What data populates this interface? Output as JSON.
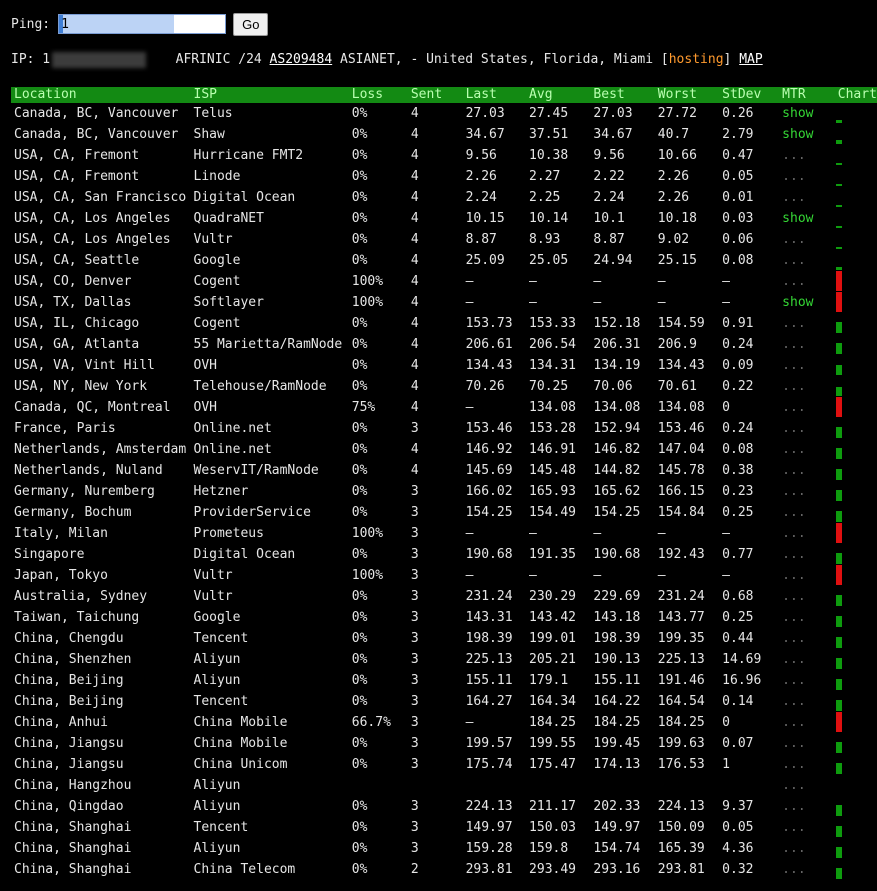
{
  "ping": {
    "label": "Ping:",
    "value": "1",
    "button": "Go"
  },
  "ipinfo": {
    "prefix": "IP: 1",
    "registry": "AFRINIC /24",
    "asn": "AS209484",
    "location": "ASIANET, - United States, Florida, Miami",
    "bracket_open": "[",
    "hosting": "hosting",
    "bracket_close": "]",
    "map": "MAP"
  },
  "columns": [
    "Location",
    "ISP",
    "Loss",
    "Sent",
    "Last",
    "Avg",
    "Best",
    "Worst",
    "StDev",
    "MTR",
    "Chart"
  ],
  "colors": {
    "header_bg": "#138a13",
    "show": "#35d735",
    "hosting": "#ff9a2e",
    "bar_ok": "#0e9c0e",
    "bar_bad": "#e01010"
  },
  "rows": [
    {
      "location": "Canada, BC, Vancouver",
      "isp": "Telus",
      "loss": "0%",
      "sent": "4",
      "last": "27.03",
      "avg": "27.45",
      "best": "27.03",
      "worst": "27.72",
      "stdev": "0.26",
      "mtr": "show",
      "bar": "ok",
      "level": 0.15
    },
    {
      "location": "Canada, BC, Vancouver",
      "isp": "Shaw",
      "loss": "0%",
      "sent": "4",
      "last": "34.67",
      "avg": "37.51",
      "best": "34.67",
      "worst": "40.7",
      "stdev": "2.79",
      "mtr": "show",
      "bar": "ok",
      "level": 0.2
    },
    {
      "location": "USA, CA, Fremont",
      "isp": "Hurricane FMT2",
      "loss": "0%",
      "sent": "4",
      "last": "9.56",
      "avg": "10.38",
      "best": "9.56",
      "worst": "10.66",
      "stdev": "0.47",
      "mtr": "...",
      "bar": "ok",
      "level": 0.08
    },
    {
      "location": "USA, CA, Fremont",
      "isp": "Linode",
      "loss": "0%",
      "sent": "4",
      "last": "2.26",
      "avg": "2.27",
      "best": "2.22",
      "worst": "2.26",
      "stdev": "0.05",
      "mtr": "...",
      "bar": "ok",
      "level": 0.05
    },
    {
      "location": "USA, CA, San Francisco",
      "isp": "Digital Ocean",
      "loss": "0%",
      "sent": "4",
      "last": "2.24",
      "avg": "2.25",
      "best": "2.24",
      "worst": "2.26",
      "stdev": "0.01",
      "mtr": "...",
      "bar": "ok",
      "level": 0.05
    },
    {
      "location": "USA, CA, Los Angeles",
      "isp": "QuadraNET",
      "loss": "0%",
      "sent": "4",
      "last": "10.15",
      "avg": "10.14",
      "best": "10.1",
      "worst": "10.18",
      "stdev": "0.03",
      "mtr": "show",
      "bar": "ok",
      "level": 0.08
    },
    {
      "location": "USA, CA, Los Angeles",
      "isp": "Vultr",
      "loss": "0%",
      "sent": "4",
      "last": "8.87",
      "avg": "8.93",
      "best": "8.87",
      "worst": "9.02",
      "stdev": "0.06",
      "mtr": "...",
      "bar": "ok",
      "level": 0.08
    },
    {
      "location": "USA, CA, Seattle",
      "isp": "Google",
      "loss": "0%",
      "sent": "4",
      "last": "25.09",
      "avg": "25.05",
      "best": "24.94",
      "worst": "25.15",
      "stdev": "0.08",
      "mtr": "...",
      "bar": "ok",
      "level": 0.15
    },
    {
      "location": "USA, CO, Denver",
      "isp": "Cogent",
      "loss": "100%",
      "sent": "4",
      "last": "–",
      "avg": "–",
      "best": "–",
      "worst": "–",
      "stdev": "–",
      "mtr": "...",
      "bar": "bad",
      "level": 1
    },
    {
      "location": "USA, TX, Dallas",
      "isp": "Softlayer",
      "loss": "100%",
      "sent": "4",
      "last": "–",
      "avg": "–",
      "best": "–",
      "worst": "–",
      "stdev": "–",
      "mtr": "show",
      "bar": "bad",
      "level": 1
    },
    {
      "location": "USA, IL, Chicago",
      "isp": "Cogent",
      "loss": "0%",
      "sent": "4",
      "last": "153.73",
      "avg": "153.33",
      "best": "152.18",
      "worst": "154.59",
      "stdev": "0.91",
      "mtr": "...",
      "bar": "ok",
      "level": 0.55
    },
    {
      "location": "USA, GA, Atlanta",
      "isp": "55 Marietta/RamNode",
      "loss": "0%",
      "sent": "4",
      "last": "206.61",
      "avg": "206.54",
      "best": "206.31",
      "worst": "206.9",
      "stdev": "0.24",
      "mtr": "...",
      "bar": "ok",
      "level": 0.55
    },
    {
      "location": "USA, VA, Vint Hill",
      "isp": "OVH",
      "loss": "0%",
      "sent": "4",
      "last": "134.43",
      "avg": "134.31",
      "best": "134.19",
      "worst": "134.43",
      "stdev": "0.09",
      "mtr": "...",
      "bar": "ok",
      "level": 0.5
    },
    {
      "location": "USA, NY, New York",
      "isp": "Telehouse/RamNode",
      "loss": "0%",
      "sent": "4",
      "last": "70.26",
      "avg": "70.25",
      "best": "70.06",
      "worst": "70.61",
      "stdev": "0.22",
      "mtr": "...",
      "bar": "ok",
      "level": 0.45
    },
    {
      "location": "Canada, QC, Montreal",
      "isp": "OVH",
      "loss": "75%",
      "sent": "4",
      "last": "–",
      "avg": "134.08",
      "best": "134.08",
      "worst": "134.08",
      "stdev": "0",
      "mtr": "...",
      "bar": "bad",
      "level": 1
    },
    {
      "location": "France, Paris",
      "isp": "Online.net",
      "loss": "0%",
      "sent": "3",
      "last": "153.46",
      "avg": "153.28",
      "best": "152.94",
      "worst": "153.46",
      "stdev": "0.24",
      "mtr": "...",
      "bar": "ok",
      "level": 0.55
    },
    {
      "location": "Netherlands, Amsterdam",
      "isp": "Online.net",
      "loss": "0%",
      "sent": "4",
      "last": "146.92",
      "avg": "146.91",
      "best": "146.82",
      "worst": "147.04",
      "stdev": "0.08",
      "mtr": "...",
      "bar": "ok",
      "level": 0.55
    },
    {
      "location": "Netherlands, Nuland",
      "isp": "WeservIT/RamNode",
      "loss": "0%",
      "sent": "4",
      "last": "145.69",
      "avg": "145.48",
      "best": "144.82",
      "worst": "145.78",
      "stdev": "0.38",
      "mtr": "...",
      "bar": "ok",
      "level": 0.55
    },
    {
      "location": "Germany, Nuremberg",
      "isp": "Hetzner",
      "loss": "0%",
      "sent": "3",
      "last": "166.02",
      "avg": "165.93",
      "best": "165.62",
      "worst": "166.15",
      "stdev": "0.23",
      "mtr": "...",
      "bar": "ok",
      "level": 0.55
    },
    {
      "location": "Germany, Bochum",
      "isp": "ProviderService",
      "loss": "0%",
      "sent": "3",
      "last": "154.25",
      "avg": "154.49",
      "best": "154.25",
      "worst": "154.84",
      "stdev": "0.25",
      "mtr": "...",
      "bar": "ok",
      "level": 0.55
    },
    {
      "location": "Italy, Milan",
      "isp": "Prometeus",
      "loss": "100%",
      "sent": "3",
      "last": "–",
      "avg": "–",
      "best": "–",
      "worst": "–",
      "stdev": "–",
      "mtr": "...",
      "bar": "bad",
      "level": 1
    },
    {
      "location": "Singapore",
      "isp": "Digital Ocean",
      "loss": "0%",
      "sent": "3",
      "last": "190.68",
      "avg": "191.35",
      "best": "190.68",
      "worst": "192.43",
      "stdev": "0.77",
      "mtr": "...",
      "bar": "ok",
      "level": 0.55
    },
    {
      "location": "Japan, Tokyo",
      "isp": "Vultr",
      "loss": "100%",
      "sent": "3",
      "last": "–",
      "avg": "–",
      "best": "–",
      "worst": "–",
      "stdev": "–",
      "mtr": "...",
      "bar": "bad",
      "level": 1
    },
    {
      "location": "Australia, Sydney",
      "isp": "Vultr",
      "loss": "0%",
      "sent": "3",
      "last": "231.24",
      "avg": "230.29",
      "best": "229.69",
      "worst": "231.24",
      "stdev": "0.68",
      "mtr": "...",
      "bar": "ok",
      "level": 0.55
    },
    {
      "location": "Taiwan, Taichung",
      "isp": "Google",
      "loss": "0%",
      "sent": "3",
      "last": "143.31",
      "avg": "143.42",
      "best": "143.18",
      "worst": "143.77",
      "stdev": "0.25",
      "mtr": "...",
      "bar": "ok",
      "level": 0.55
    },
    {
      "location": "China, Chengdu",
      "isp": "Tencent",
      "loss": "0%",
      "sent": "3",
      "last": "198.39",
      "avg": "199.01",
      "best": "198.39",
      "worst": "199.35",
      "stdev": "0.44",
      "mtr": "...",
      "bar": "ok",
      "level": 0.55
    },
    {
      "location": "China, Shenzhen",
      "isp": "Aliyun",
      "loss": "0%",
      "sent": "3",
      "last": "225.13",
      "avg": "205.21",
      "best": "190.13",
      "worst": "225.13",
      "stdev": "14.69",
      "mtr": "...",
      "bar": "ok",
      "level": 0.55
    },
    {
      "location": "China, Beijing",
      "isp": "Aliyun",
      "loss": "0%",
      "sent": "3",
      "last": "155.11",
      "avg": "179.1",
      "best": "155.11",
      "worst": "191.46",
      "stdev": "16.96",
      "mtr": "...",
      "bar": "ok",
      "level": 0.55
    },
    {
      "location": "China, Beijing",
      "isp": "Tencent",
      "loss": "0%",
      "sent": "3",
      "last": "164.27",
      "avg": "164.34",
      "best": "164.22",
      "worst": "164.54",
      "stdev": "0.14",
      "mtr": "...",
      "bar": "ok",
      "level": 0.55
    },
    {
      "location": "China, Anhui",
      "isp": "China Mobile",
      "loss": "66.7%",
      "sent": "3",
      "last": "–",
      "avg": "184.25",
      "best": "184.25",
      "worst": "184.25",
      "stdev": "0",
      "mtr": "...",
      "bar": "bad",
      "level": 1
    },
    {
      "location": "China, Jiangsu",
      "isp": "China Mobile",
      "loss": "0%",
      "sent": "3",
      "last": "199.57",
      "avg": "199.55",
      "best": "199.45",
      "worst": "199.63",
      "stdev": "0.07",
      "mtr": "...",
      "bar": "ok",
      "level": 0.55
    },
    {
      "location": "China, Jiangsu",
      "isp": "China Unicom",
      "loss": "0%",
      "sent": "3",
      "last": "175.74",
      "avg": "175.47",
      "best": "174.13",
      "worst": "176.53",
      "stdev": "1",
      "mtr": "...",
      "bar": "ok",
      "level": 0.55
    },
    {
      "location": "China, Hangzhou",
      "isp": "Aliyun",
      "loss": "",
      "sent": "",
      "last": "",
      "avg": "",
      "best": "",
      "worst": "",
      "stdev": "",
      "mtr": "...",
      "bar": "none",
      "level": 0
    },
    {
      "location": "China, Qingdao",
      "isp": "Aliyun",
      "loss": "0%",
      "sent": "3",
      "last": "224.13",
      "avg": "211.17",
      "best": "202.33",
      "worst": "224.13",
      "stdev": "9.37",
      "mtr": "...",
      "bar": "ok",
      "level": 0.55
    },
    {
      "location": "China, Shanghai",
      "isp": "Tencent",
      "loss": "0%",
      "sent": "3",
      "last": "149.97",
      "avg": "150.03",
      "best": "149.97",
      "worst": "150.09",
      "stdev": "0.05",
      "mtr": "...",
      "bar": "ok",
      "level": 0.55
    },
    {
      "location": "China, Shanghai",
      "isp": "Aliyun",
      "loss": "0%",
      "sent": "3",
      "last": "159.28",
      "avg": "159.8",
      "best": "154.74",
      "worst": "165.39",
      "stdev": "4.36",
      "mtr": "...",
      "bar": "ok",
      "level": 0.55
    },
    {
      "location": "China, Shanghai",
      "isp": "China Telecom",
      "loss": "0%",
      "sent": "2",
      "last": "293.81",
      "avg": "293.49",
      "best": "293.16",
      "worst": "293.81",
      "stdev": "0.32",
      "mtr": "...",
      "bar": "ok",
      "level": 0.55
    }
  ]
}
